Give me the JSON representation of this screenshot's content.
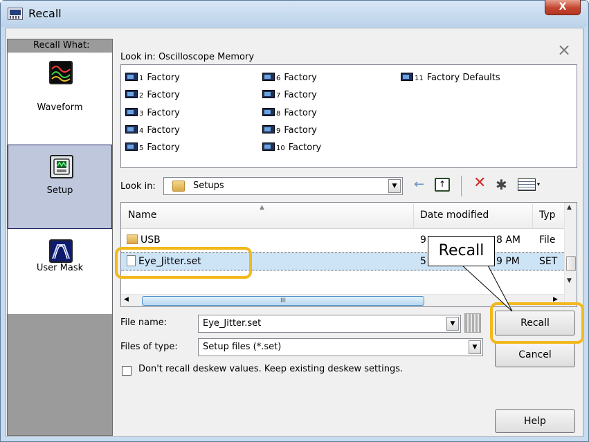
{
  "window": {
    "title": "Recall",
    "close_glyph": "X"
  },
  "left_panel": {
    "label": "Recall What:",
    "items": [
      {
        "label": "Waveform",
        "icon": "waveform-icon"
      },
      {
        "label": "Setup",
        "icon": "setup-icon",
        "selected": true
      },
      {
        "label": "User Mask",
        "icon": "user-mask-icon"
      }
    ]
  },
  "memory": {
    "lookin_label": "Look in: Oscilloscope Memory",
    "dismiss_glyph": "×",
    "items": [
      {
        "num": "1",
        "label": "Factory"
      },
      {
        "num": "2",
        "label": "Factory"
      },
      {
        "num": "3",
        "label": "Factory"
      },
      {
        "num": "4",
        "label": "Factory"
      },
      {
        "num": "5",
        "label": "Factory"
      },
      {
        "num": "6",
        "label": "Factory"
      },
      {
        "num": "7",
        "label": "Factory"
      },
      {
        "num": "8",
        "label": "Factory"
      },
      {
        "num": "9",
        "label": "Factory"
      },
      {
        "num": "10",
        "label": "Factory"
      },
      {
        "num": "11",
        "label": "Factory Defaults"
      }
    ]
  },
  "lookin": {
    "label": "Look in:",
    "value": "Setups",
    "arrow": "▼"
  },
  "toolbar": {
    "back_glyph": "←",
    "up_glyph": "↑",
    "delete_glyph": "✕",
    "new_folder_glyph": "✱",
    "view_arrow": "▾"
  },
  "file_list": {
    "columns": [
      "Name",
      "Date modified",
      "Typ"
    ],
    "sort_glyph": "▲",
    "rows": [
      {
        "name": "USB",
        "date": "9",
        "date_tail": "8 AM",
        "type": "File"
      },
      {
        "name": "Eye_Jitter.set",
        "date": "5",
        "date_tail": "9 PM",
        "type": "SET",
        "selected": true
      }
    ],
    "scroll_up": "▲",
    "scroll_down": "▼",
    "scroll_left": "◀",
    "scroll_right": "▶",
    "thumb_grip": "III"
  },
  "file_name": {
    "label": "File name:",
    "value": "Eye_Jitter.set",
    "arrow": "▼"
  },
  "file_type": {
    "label": "Files of type:",
    "value": "Setup files (*.set)",
    "arrow": "▼"
  },
  "deskew": {
    "label": "Don't recall deskew values. Keep existing deskew settings.",
    "checked": false
  },
  "buttons": {
    "recall": "Recall",
    "cancel": "Cancel",
    "help": "Help"
  },
  "callout": {
    "text": "Recall",
    "highlight_color": "#f2b81c"
  }
}
